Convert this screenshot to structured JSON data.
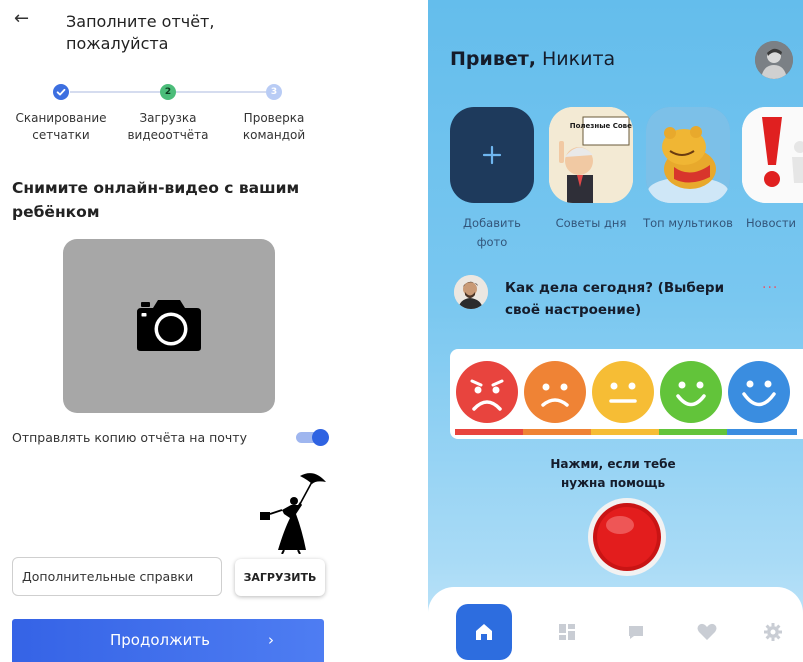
{
  "report": {
    "title": "Заполните отчёт, пожалуйста",
    "steps": [
      {
        "label": "Сканирование сетчатки",
        "state": "done",
        "color": "#3d6fe0"
      },
      {
        "label": "Загрузка видеоотчёта",
        "badge": "2",
        "state": "active",
        "color": "#4cbd7a"
      },
      {
        "label": "Проверка командой",
        "badge": "3",
        "state": "pending",
        "color": "#b9ccf5"
      }
    ],
    "section_title": "Снимите онлайн-видео с вашим ребёнком",
    "camera_icon": "camera-icon",
    "email_copy_label": "Отправлять копию отчёта на почту",
    "email_copy_enabled": true,
    "extra_input_value": "Дополнительные справки",
    "upload_label": "ЗАГРУЗИТЬ",
    "continue_label": "Продолжить",
    "continue_arrow": "›",
    "back_arrow": "←",
    "accent_color": "#3563e6"
  },
  "app": {
    "greeting_bold": "Привет,",
    "greeting_name": "Никита",
    "stories": [
      {
        "label": "Добавить фото",
        "icon": "plus-icon"
      },
      {
        "label": "Советы дня",
        "image_text": "Полезные Советы"
      },
      {
        "label": "Топ мультиков"
      },
      {
        "label": "Новости"
      }
    ],
    "mood_question": "Как дела сегодня? (Выбери своё настроение)",
    "more_dots": "···",
    "moods": [
      {
        "face": "angry",
        "color": "#e8443e"
      },
      {
        "face": "sad",
        "color": "#ef8335"
      },
      {
        "face": "neutral",
        "color": "#f6bd35"
      },
      {
        "face": "happy",
        "color": "#62c43a"
      },
      {
        "face": "very-happy",
        "color": "#3a8de0"
      }
    ],
    "help_text": "Нажми, если тебе нужна помощь",
    "panic_color": "#e31d1d",
    "nav_items": [
      "home-icon",
      "dashboard-icon",
      "chat-icon",
      "heart-icon",
      "gear-icon"
    ],
    "active_nav": "home-icon",
    "nav_active_color": "#2d6ddf"
  }
}
